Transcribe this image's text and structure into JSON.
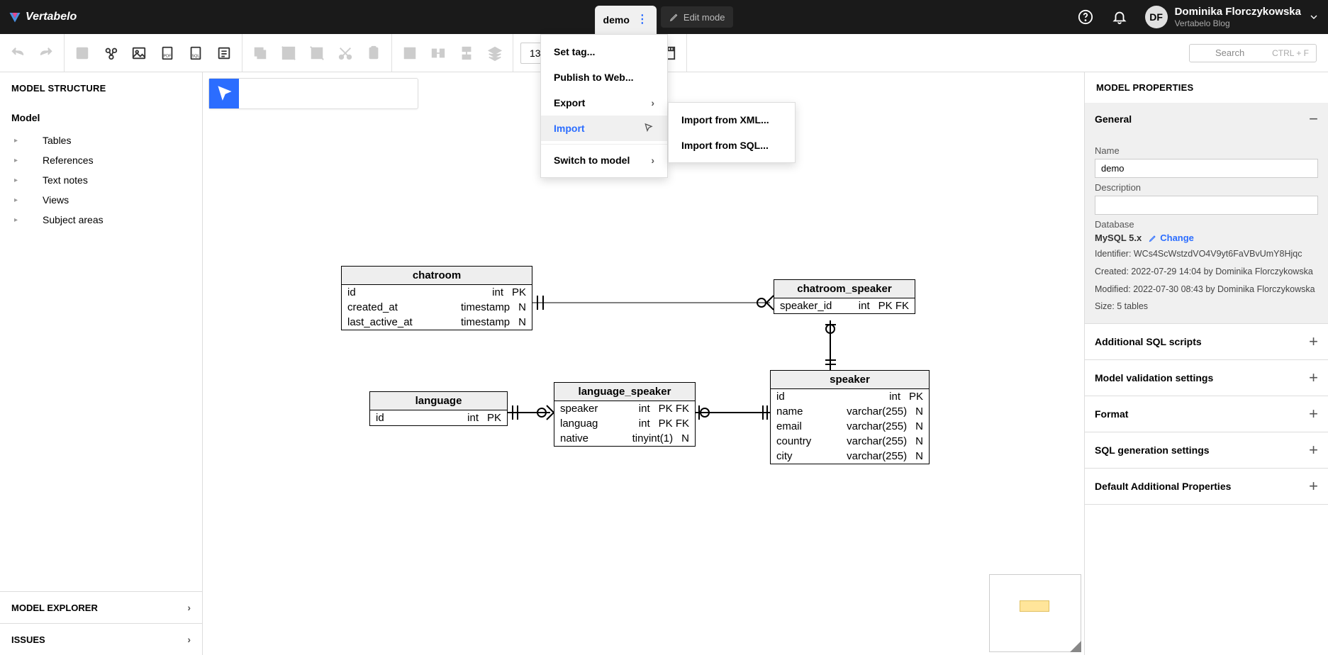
{
  "brand": "Vertabelo",
  "top": {
    "tab_name": "demo",
    "edit_mode": "Edit mode"
  },
  "user": {
    "initials": "DF",
    "name": "Dominika Florczykowska",
    "subtitle": "Vertabelo Blog"
  },
  "toolbar": {
    "zoom": "139%",
    "search_placeholder": "Search",
    "search_shortcut": "CTRL + F"
  },
  "left_panel": {
    "structure_title": "MODEL STRUCTURE",
    "model_label": "Model",
    "items": [
      "Tables",
      "References",
      "Text notes",
      "Views",
      "Subject areas"
    ],
    "explorer": "MODEL EXPLORER",
    "issues": "ISSUES"
  },
  "context_menu": {
    "items": [
      "Set tag...",
      "Publish to Web...",
      "Export",
      "Import",
      "Switch to model"
    ],
    "submenu": [
      "Import from XML...",
      "Import from SQL..."
    ]
  },
  "er": {
    "chatroom": {
      "title": "chatroom",
      "rows": [
        [
          "id",
          "int",
          "PK"
        ],
        [
          "created_at",
          "timestamp",
          "N"
        ],
        [
          "last_active_at",
          "timestamp",
          "N"
        ]
      ]
    },
    "chatroom_speaker": {
      "title": "chatroom_speaker",
      "rows": [
        [
          "speaker_id",
          "int",
          "PK FK"
        ]
      ]
    },
    "language": {
      "title": "language",
      "rows": [
        [
          "id",
          "int",
          "PK"
        ]
      ]
    },
    "language_speaker": {
      "title": "language_speaker",
      "rows": [
        [
          "speaker",
          "int",
          "PK FK"
        ],
        [
          "languag",
          "int",
          "PK FK"
        ],
        [
          "native",
          "tinyint(1)",
          "N"
        ]
      ]
    },
    "speaker": {
      "title": "speaker",
      "rows": [
        [
          "id",
          "int",
          "PK"
        ],
        [
          "name",
          "varchar(255)",
          "N"
        ],
        [
          "email",
          "varchar(255)",
          "N"
        ],
        [
          "country",
          "varchar(255)",
          "N"
        ],
        [
          "city",
          "varchar(255)",
          "N"
        ]
      ]
    }
  },
  "right_panel": {
    "title": "MODEL PROPERTIES",
    "general": "General",
    "name_label": "Name",
    "name_value": "demo",
    "desc_label": "Description",
    "desc_value": "",
    "db_label": "Database",
    "db_value": "MySQL 5.x",
    "change": "Change",
    "identifier": "Identifier: WCs4ScWstzdVO4V9yt6FaVBvUmY8Hjqc",
    "created": "Created: 2022-07-29 14:04 by Dominika Florczykowska",
    "modified": "Modified: 2022-07-30 08:43 by Dominika Florczykowska",
    "size": "Size: 5 tables",
    "sections": [
      "Additional SQL scripts",
      "Model validation settings",
      "Format",
      "SQL generation settings",
      "Default Additional Properties"
    ]
  }
}
